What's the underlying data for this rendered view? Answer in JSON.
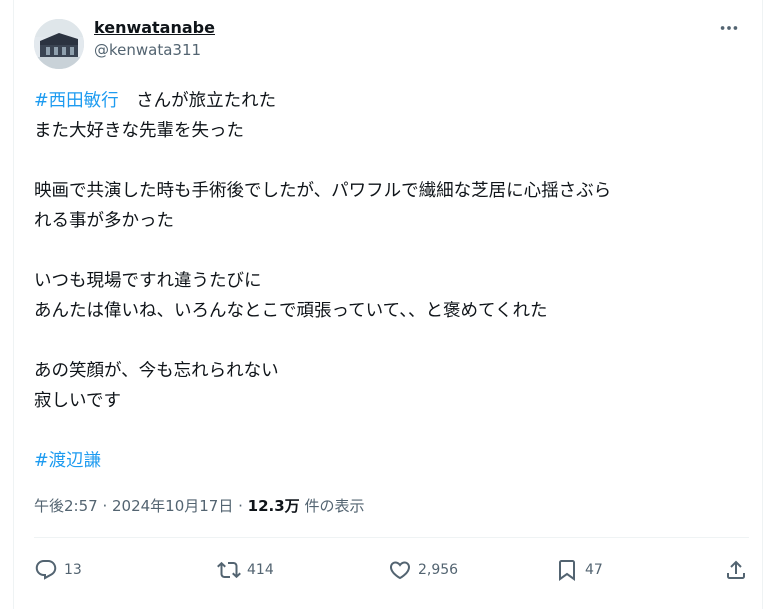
{
  "user": {
    "display_name": "kenwatanabe",
    "handle": "@kenwata311"
  },
  "tweet": {
    "line1_hashtag": "#西田敏行",
    "line1_rest": "　さんが旅立たれた",
    "line2": "また大好きな先輩を失った",
    "line3": "映画で共演した時も手術後でしたが、パワフルで繊細な芝居に心揺さぶら",
    "line4": "れる事が多かった",
    "line5": "いつも現場ですれ違うたびに",
    "line6": "あんたは偉いね、いろんなとこで頑張っていて、、と褒めてくれた",
    "line7": "あの笑顔が、今も忘れられない",
    "line8": "寂しいです",
    "hashtag2": "#渡辺謙"
  },
  "meta": {
    "time": "午後2:57",
    "sep1": " · ",
    "date": "2024年10月17日",
    "sep2": " · ",
    "views": "12.3万",
    "views_label": " 件の表示"
  },
  "actions": {
    "replies": "13",
    "retweets": "414",
    "likes": "2,956",
    "bookmarks": "47"
  },
  "colors": {
    "link": "#1d9bf0",
    "secondary_text": "#536471",
    "primary_text": "#0f1419"
  }
}
